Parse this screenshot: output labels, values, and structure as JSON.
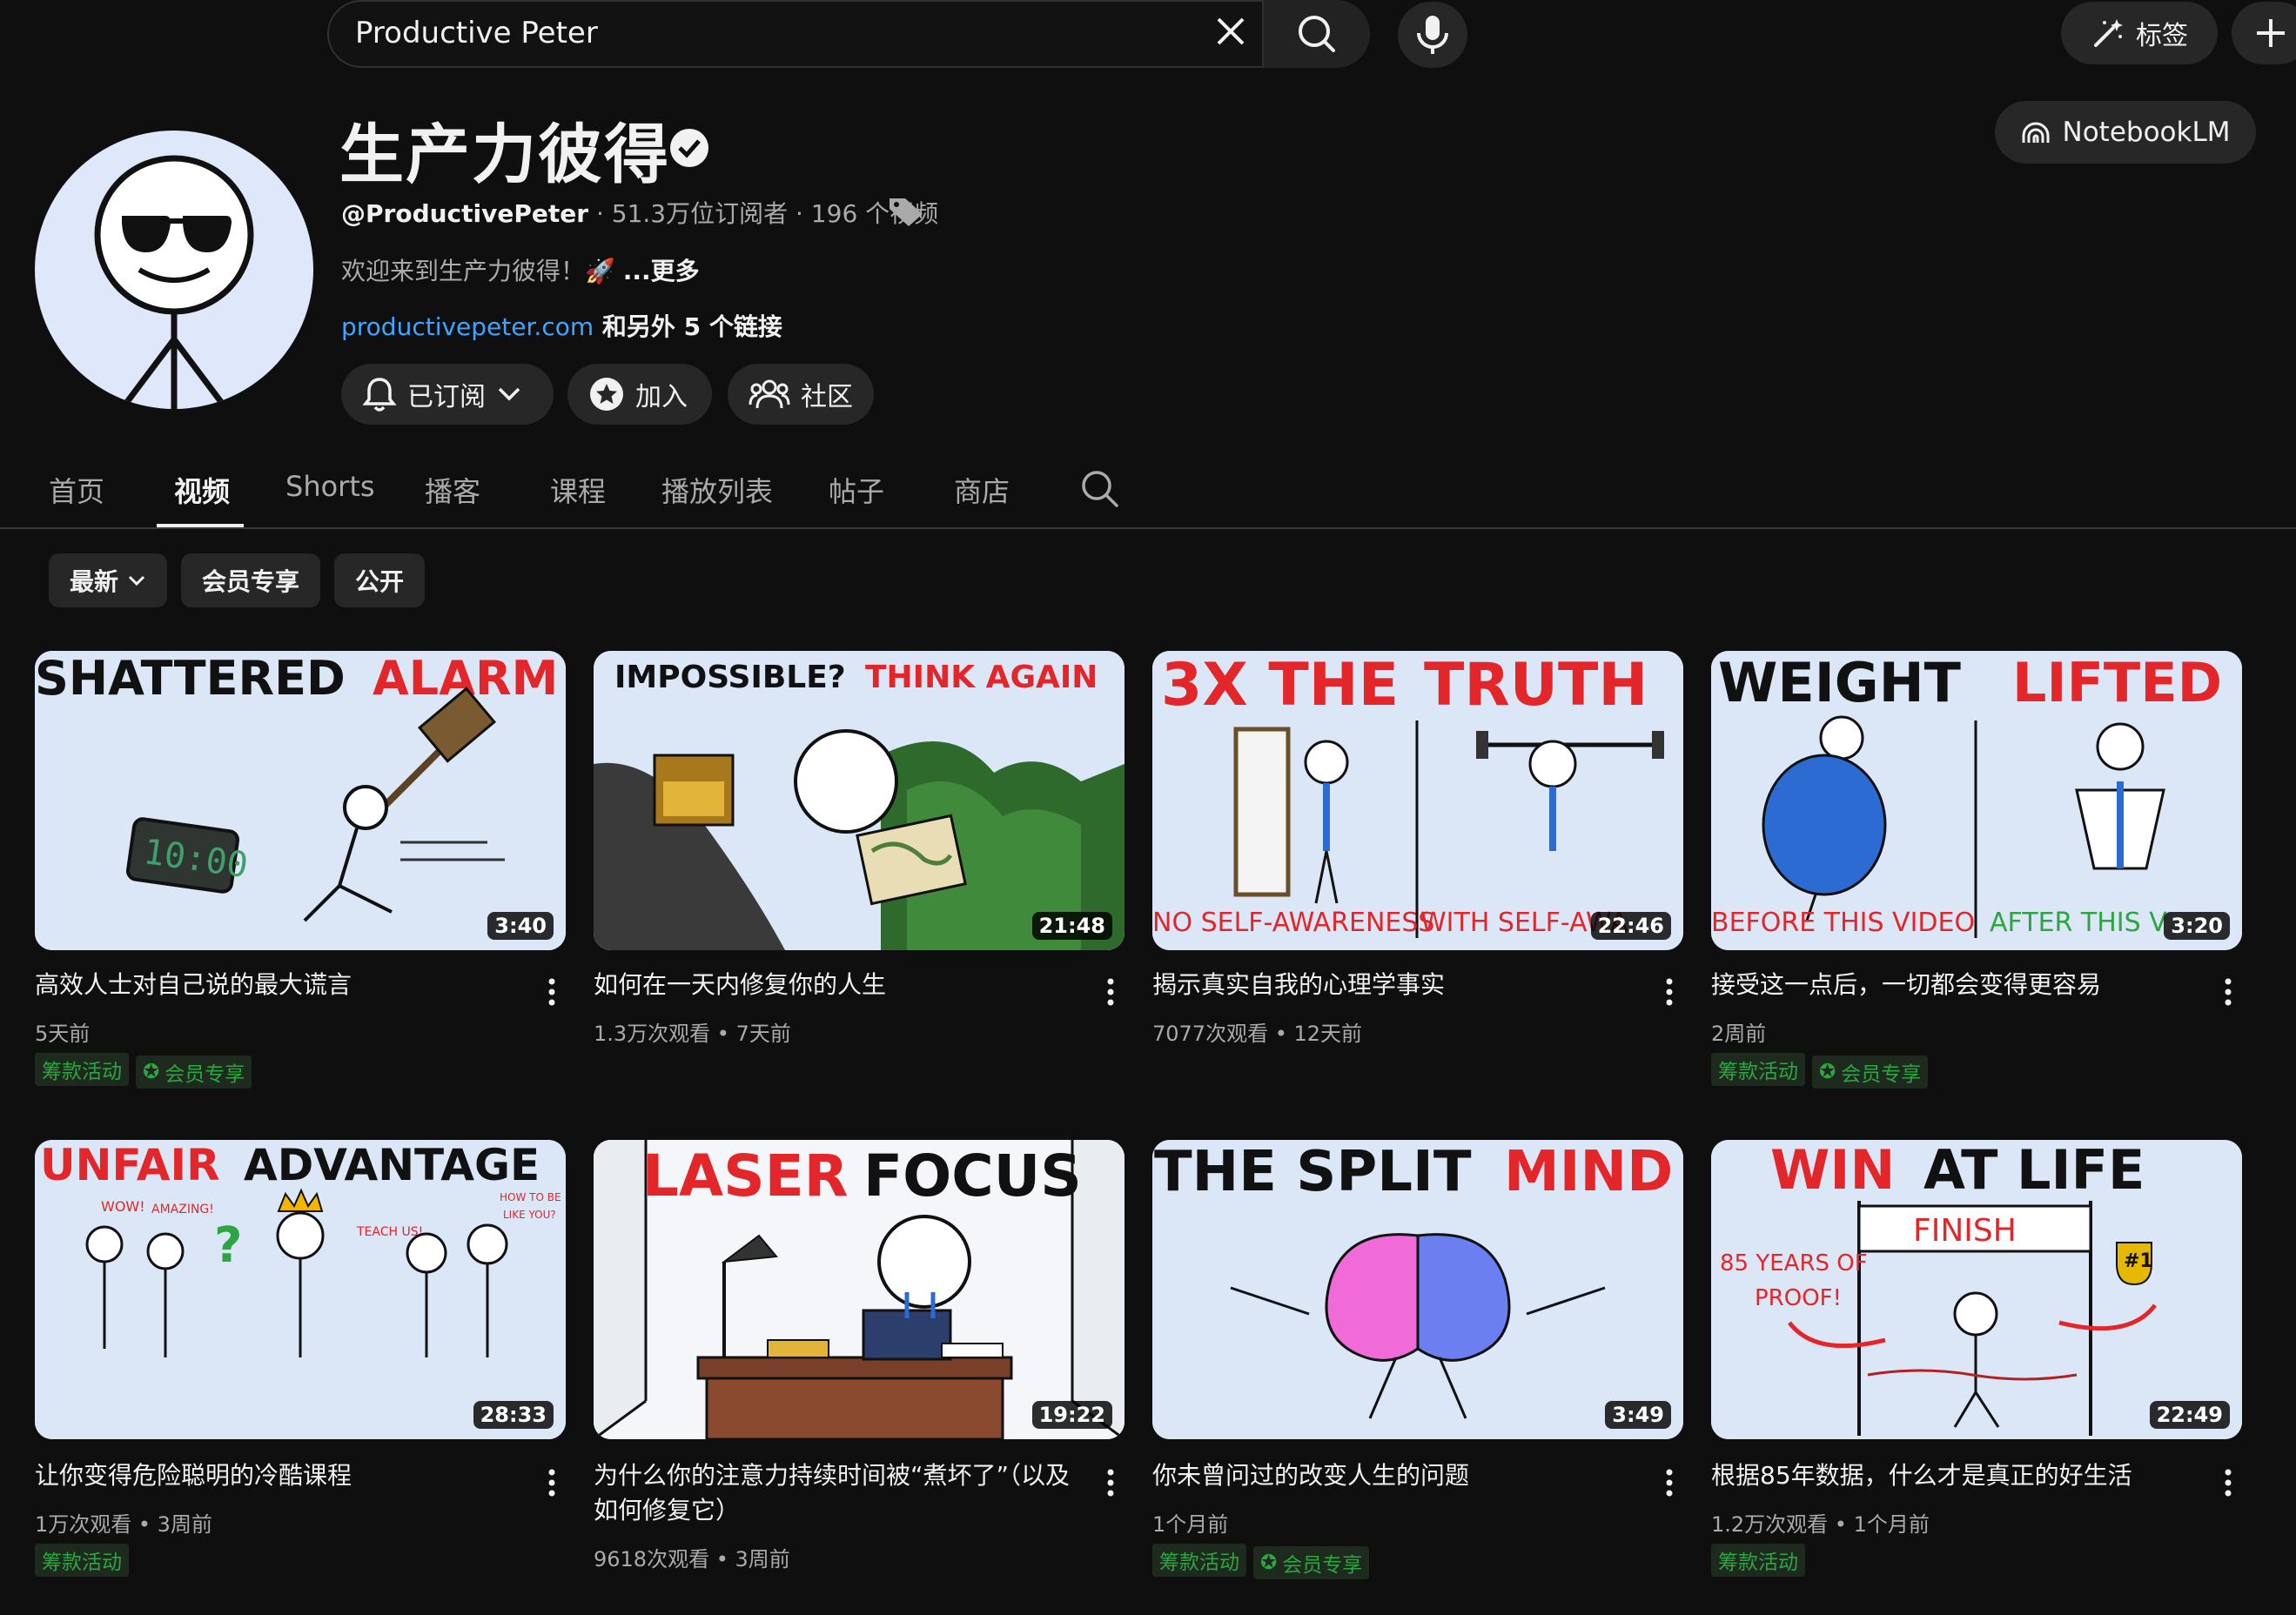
{
  "search": {
    "value": "Productive Peter"
  },
  "topbar": {
    "tag_label": "标签"
  },
  "channel": {
    "name": "生产力彼得",
    "handle": "@ProductivePeter",
    "stats": " · 51.3万位订阅者 · 196 个视频",
    "description": "欢迎来到生产力彼得！🚀 ",
    "more": "...更多",
    "link_url": "productivepeter.com",
    "link_extra": " 和另外 5 个链接",
    "subscribed_label": "已订阅",
    "join_label": "加入",
    "community_label": "社区",
    "notebook_label": "NotebookLM"
  },
  "tabs": [
    "首页",
    "视频",
    "Shorts",
    "播客",
    "课程",
    "播放列表",
    "帖子",
    "商店"
  ],
  "chips": {
    "latest": "最新",
    "members": "会员专享",
    "public": "公开"
  },
  "videos": [
    {
      "thumb_a": "SHATTERED",
      "thumb_b": "ALARM",
      "duration": "3:40",
      "title": "高效人士对自己说的最大谎言",
      "meta": "5天前",
      "badges": [
        "筹款活动",
        "会员专享"
      ]
    },
    {
      "thumb_a": "IMPOSSIBLE?",
      "thumb_b": "THINK AGAIN",
      "duration": "21:48",
      "title": "如何在一天内修复你的人生",
      "meta": "1.3万次观看 • 7天前",
      "badges": []
    },
    {
      "thumb_a": "3X THE",
      "thumb_b": "TRUTH",
      "duration": "22:46",
      "title": "揭示真实自我的心理学事实",
      "meta": "7077次观看 • 12天前",
      "badges": [],
      "caption_l": "NO SELF-AWARENESS",
      "caption_r": "WITH SELF-AWA"
    },
    {
      "thumb_a": "WEIGHT",
      "thumb_b": "LIFTED",
      "duration": "3:20",
      "title": "接受这一点后，一切都会变得更容易",
      "meta": "2周前",
      "badges": [
        "筹款活动",
        "会员专享"
      ],
      "caption_l": "BEFORE THIS VIDEO",
      "caption_r": "AFTER THIS V"
    },
    {
      "thumb_a": "UNFAIR",
      "thumb_b": "ADVANTAGE",
      "duration": "28:33",
      "title": "让你变得危险聪明的冷酷课程",
      "meta": "1万次观看 • 3周前",
      "badges": [
        "筹款活动"
      ],
      "words": [
        "WOW!",
        "AMAZING!",
        "TEACH US!",
        "HOW TO BE",
        "LIKE YOU?"
      ]
    },
    {
      "thumb_a": "LASER",
      "thumb_b": "FOCUS",
      "duration": "19:22",
      "title": "为什么你的注意力持续时间被“煮坏了”（以及如何修复它）",
      "meta": "9618次观看 • 3周前",
      "badges": []
    },
    {
      "thumb_a": "THE SPLIT",
      "thumb_b": "MIND",
      "duration": "3:49",
      "title": "你未曾问过的改变人生的问题",
      "meta": "1个月前",
      "badges": [
        "筹款活动",
        "会员专享"
      ]
    },
    {
      "thumb_a": "WIN",
      "thumb_b": "AT LIFE",
      "duration": "22:49",
      "title": "根据85年数据，什么才是真正的好生活",
      "meta": "1.2万次观看 • 1个月前",
      "badges": [
        "筹款活动"
      ],
      "words": [
        "FINISH",
        "85 YEARS OF",
        "PROOF!",
        "#1"
      ]
    }
  ],
  "colors": {
    "accent_red": "#e3262a",
    "link_blue": "#3ea6ff",
    "badge_green": "#2ba640",
    "bg": "#0f0f0f"
  }
}
